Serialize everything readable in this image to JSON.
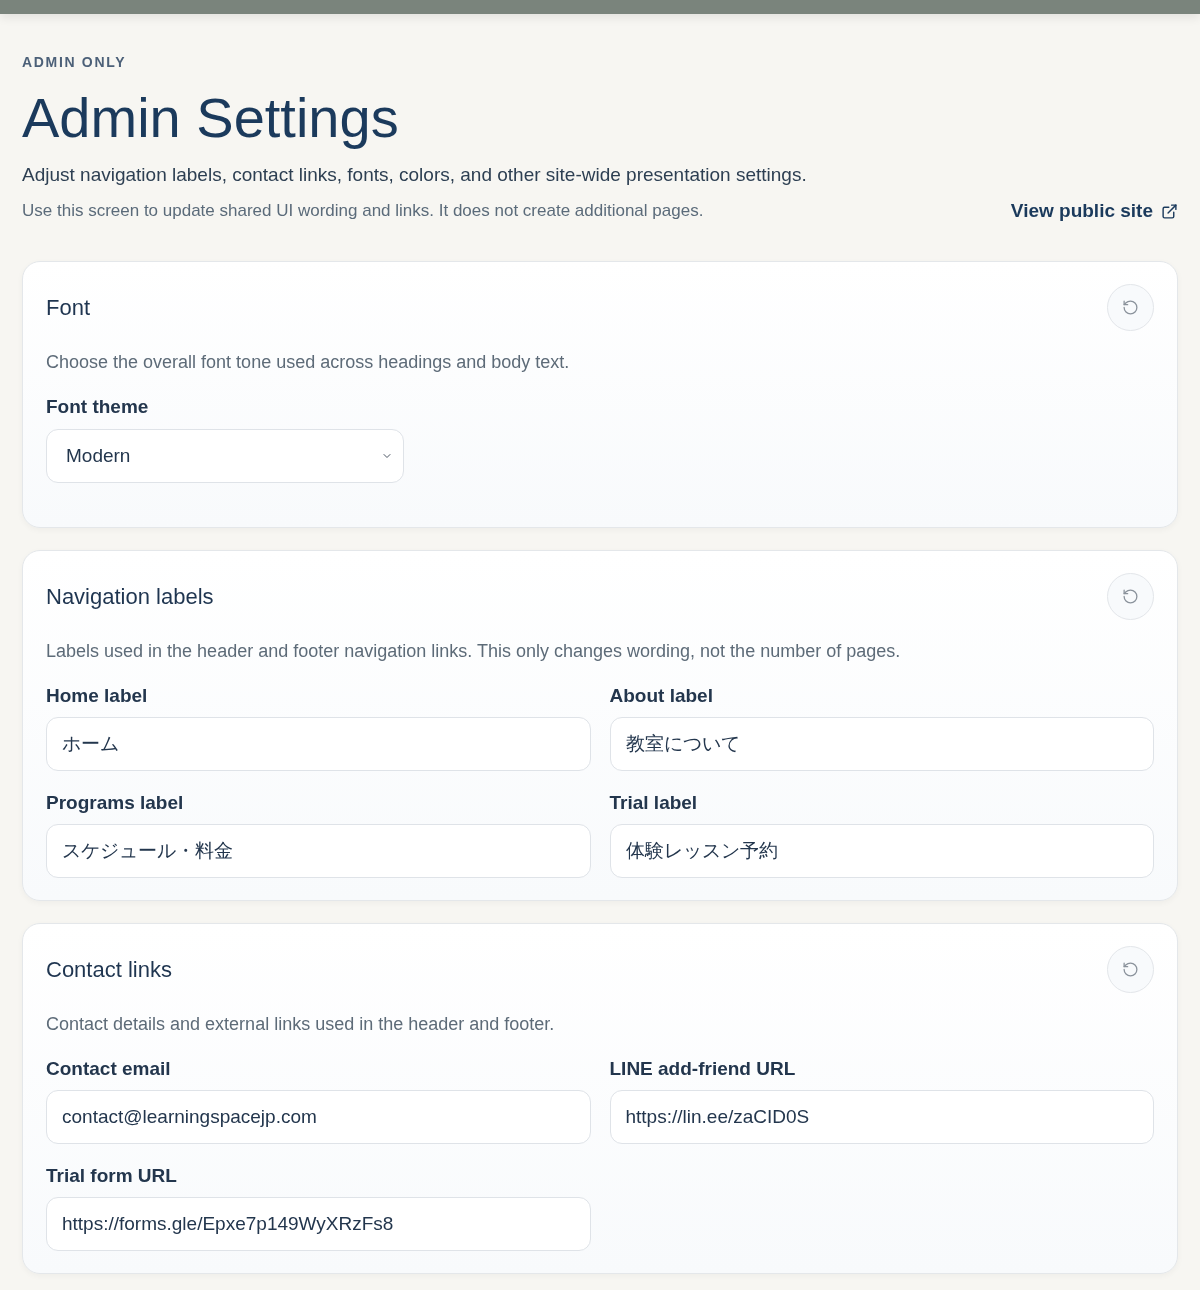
{
  "header": {
    "eyebrow": "ADMIN ONLY",
    "title": "Admin Settings",
    "subtitle": "Adjust navigation labels, contact links, fonts, colors, and other site-wide presentation settings.",
    "note": "Use this screen to update shared UI wording and links. It does not create additional pages.",
    "public_link": "View public site"
  },
  "sections": [
    {
      "title": "Font",
      "description": "Choose the overall font tone used across headings and body text.",
      "fields": [
        {
          "kind": "select",
          "label": "Font theme",
          "value": "Modern"
        }
      ]
    },
    {
      "title": "Navigation labels",
      "description": "Labels used in the header and footer navigation links. This only changes wording, not the number of pages.",
      "fields": [
        {
          "kind": "text",
          "label": "Home label",
          "value": "ホーム"
        },
        {
          "kind": "text",
          "label": "About label",
          "value": "教室について"
        },
        {
          "kind": "text",
          "label": "Programs label",
          "value": "スケジュール・料金"
        },
        {
          "kind": "text",
          "label": "Trial label",
          "value": "体験レッスン予約"
        }
      ]
    },
    {
      "title": "Contact links",
      "description": "Contact details and external links used in the header and footer.",
      "fields": [
        {
          "kind": "text",
          "label": "Contact email",
          "value": "contact@learningspacejp.com"
        },
        {
          "kind": "text",
          "label": "LINE add-friend URL",
          "value": "https://lin.ee/zaCID0S"
        },
        {
          "kind": "text",
          "label": "Trial form URL",
          "value": "https://forms.gle/Epxe7p149WyXRzFs8"
        }
      ]
    }
  ]
}
